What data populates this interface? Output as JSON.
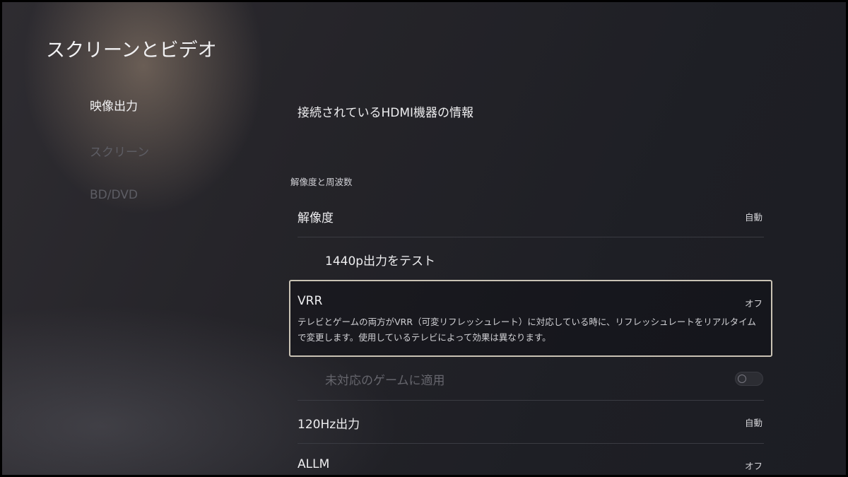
{
  "header": {
    "title": "スクリーンとビデオ"
  },
  "sidebar": {
    "items": [
      {
        "label": "映像出力"
      },
      {
        "label": "スクリーン"
      },
      {
        "label": "BD/DVD"
      }
    ]
  },
  "main": {
    "hdmi_info": "接続されているHDMI機器の情報",
    "section_label": "解像度と周波数",
    "resolution": {
      "title": "解像度",
      "value": "自動"
    },
    "test_1440p": {
      "title": "1440p出力をテスト"
    },
    "vrr": {
      "title": "VRR",
      "value": "オフ",
      "description": "テレビとゲームの両方がVRR（可変リフレッシュレート）に対応している時に、リフレッシュレートをリアルタイムで変更します。使用しているテレビによって効果は異なります。"
    },
    "unsupported_games": {
      "title": "未対応のゲームに適用",
      "enabled": false
    },
    "hz120": {
      "title": "120Hz出力",
      "value": "自動"
    },
    "allm": {
      "title": "ALLM",
      "value": "オフ"
    }
  }
}
